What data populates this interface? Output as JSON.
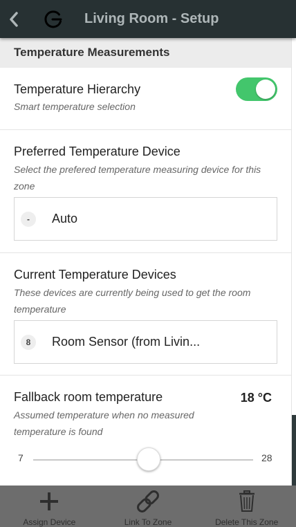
{
  "header": {
    "title": "Living Room - Setup",
    "back_icon": "chevron-left-icon",
    "logo_icon": "app-logo-icon"
  },
  "section": {
    "title": "Temperature Measurements"
  },
  "hierarchy": {
    "title": "Temperature Hierarchy",
    "subtitle": "Smart temperature selection",
    "enabled": true,
    "toggle_color": "#43c66c"
  },
  "preferred": {
    "title": "Preferred Temperature Device",
    "subtitle": "Select the prefered temperature measuring device for this zone",
    "badge": "-",
    "value": "Auto"
  },
  "current": {
    "title": "Current Temperature Devices",
    "subtitle": "These devices are currently being used to get the room temperature",
    "badge": "8",
    "value": "Room Sensor (from Livin..."
  },
  "fallback": {
    "title": "Fallback room temperature",
    "value_label": "18 °C",
    "subtitle": "Assumed temperature when no measured temperature is found",
    "slider": {
      "min": 7,
      "max": 28,
      "value": 18
    }
  },
  "footer": {
    "assign_label": "Assign Device",
    "link_label": "Link To Zone",
    "delete_label": "Delete This Zone"
  }
}
